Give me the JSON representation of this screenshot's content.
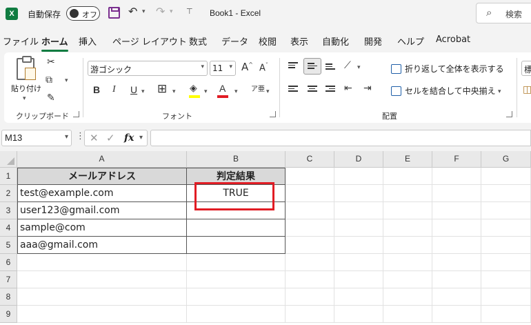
{
  "titlebar": {
    "autosave_label": "自動保存",
    "autosave_state": "オフ",
    "book_title": "Book1  -  Excel",
    "search_placeholder": "検索"
  },
  "tabs": [
    "ファイル",
    "ホーム",
    "挿入",
    "ページ レイアウト",
    "数式",
    "データ",
    "校閲",
    "表示",
    "自動化",
    "開発",
    "ヘルプ",
    "Acrobat"
  ],
  "active_tab": "ホーム",
  "ribbon": {
    "clipboard": {
      "paste_label": "貼り付け",
      "group_label": "クリップボード"
    },
    "font": {
      "font_name": "游ゴシック",
      "font_size": "11",
      "group_label": "フォント",
      "bold": "B",
      "italic": "I",
      "underline": "U",
      "grow": "A",
      "shrink": "A",
      "font_color": "A"
    },
    "alignment": {
      "wrap_text": "折り返して全体を表示する",
      "merge_center": "セルを結合して中央揃え",
      "group_label": "配置"
    },
    "overflow_label": "標"
  },
  "formula_bar": {
    "name_box": "M13",
    "fx": "fx",
    "value": ""
  },
  "sheet": {
    "columns": [
      "A",
      "B",
      "C",
      "D",
      "E",
      "F",
      "G"
    ],
    "rows": [
      "1",
      "2",
      "3",
      "4",
      "5",
      "6",
      "7",
      "8",
      "9"
    ],
    "header": {
      "a": "メールアドレス",
      "b": "判定結果"
    },
    "data": [
      {
        "a": "test@example.com",
        "b": "TRUE"
      },
      {
        "a": "user123@gmail.com",
        "b": ""
      },
      {
        "a": "sample@com",
        "b": ""
      },
      {
        "a": "aaa@gmail.com",
        "b": ""
      }
    ]
  },
  "colors": {
    "accent": "#107c41",
    "highlight_box": "#e11c24",
    "header_fill": "#d9d9d9"
  }
}
